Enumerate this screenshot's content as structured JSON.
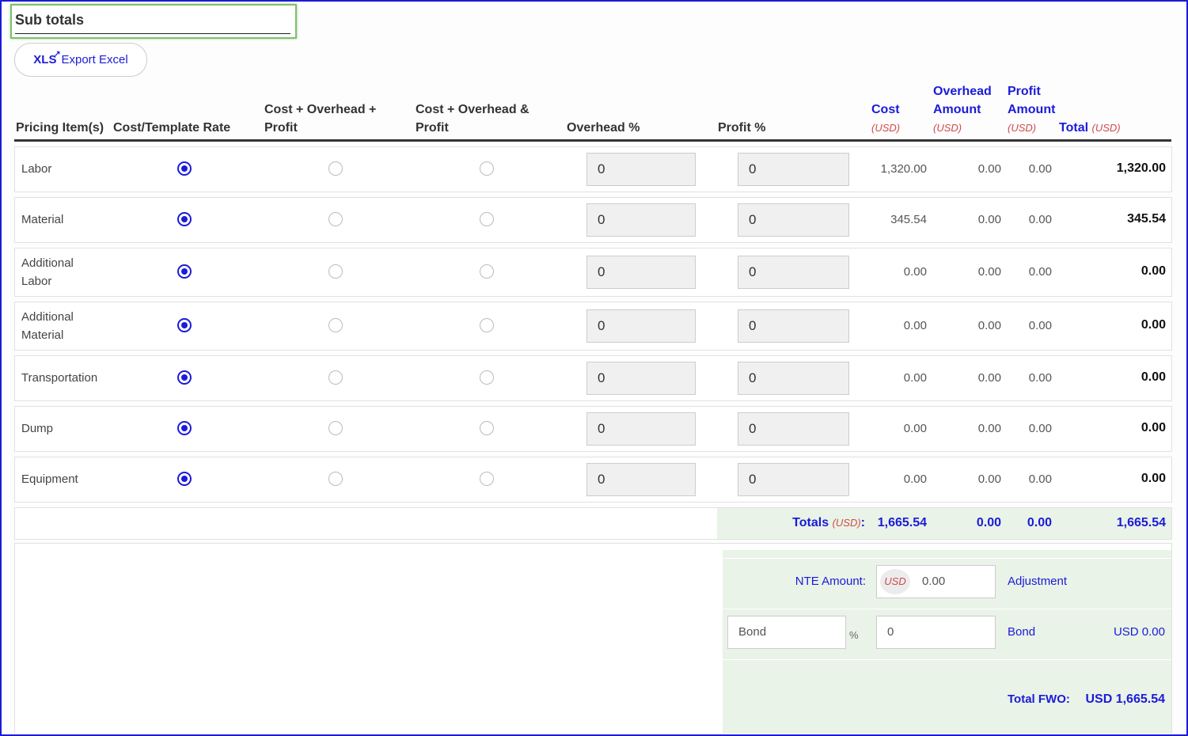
{
  "title": "Sub totals",
  "export": {
    "icon_text": "XLS",
    "label": "Export Excel"
  },
  "headers": {
    "pricing_items": "Pricing Item(s)",
    "cost_template_rate": "Cost/Template Rate",
    "cop_1": "Cost + Overhead +",
    "cop_2": "Profit",
    "coap_1": "Cost + Overhead &",
    "coap_2": "Profit",
    "overhead_pct": "Overhead %",
    "profit_pct": "Profit %",
    "cost": "Cost",
    "overhead_amount_1": "Overhead",
    "overhead_amount_2": "Amount",
    "profit_amount_1": "Profit",
    "profit_amount_2": "Amount",
    "total": "Total",
    "currency": "(USD)"
  },
  "rows": [
    {
      "label": "Labor",
      "selected": "cost_template_rate",
      "overhead_pct": "0",
      "profit_pct": "0",
      "cost": "1,320.00",
      "overhead_amount": "0.00",
      "profit_amount": "0.00",
      "total": "1,320.00"
    },
    {
      "label": "Material",
      "selected": "cost_template_rate",
      "overhead_pct": "0",
      "profit_pct": "0",
      "cost": "345.54",
      "overhead_amount": "0.00",
      "profit_amount": "0.00",
      "total": "345.54"
    },
    {
      "label_1": "Additional",
      "label_2": "Labor",
      "selected": "cost_template_rate",
      "overhead_pct": "0",
      "profit_pct": "0",
      "cost": "0.00",
      "overhead_amount": "0.00",
      "profit_amount": "0.00",
      "total": "0.00"
    },
    {
      "label_1": "Additional",
      "label_2": "Material",
      "selected": "cost_template_rate",
      "overhead_pct": "0",
      "profit_pct": "0",
      "cost": "0.00",
      "overhead_amount": "0.00",
      "profit_amount": "0.00",
      "total": "0.00"
    },
    {
      "label": "Transportation",
      "selected": "cost_template_rate",
      "overhead_pct": "0",
      "profit_pct": "0",
      "cost": "0.00",
      "overhead_amount": "0.00",
      "profit_amount": "0.00",
      "total": "0.00"
    },
    {
      "label": "Dump",
      "selected": "cost_template_rate",
      "overhead_pct": "0",
      "profit_pct": "0",
      "cost": "0.00",
      "overhead_amount": "0.00",
      "profit_amount": "0.00",
      "total": "0.00"
    },
    {
      "label": "Equipment",
      "selected": "cost_template_rate",
      "overhead_pct": "0",
      "profit_pct": "0",
      "cost": "0.00",
      "overhead_amount": "0.00",
      "profit_amount": "0.00",
      "total": "0.00"
    }
  ],
  "totals": {
    "label": "Totals",
    "currency": "(USD)",
    "colon": ":",
    "cost": "1,665.54",
    "overhead_amount": "0.00",
    "profit_amount": "0.00",
    "total": "1,665.54"
  },
  "nte": {
    "label": "NTE Amount:",
    "currency_badge": "USD",
    "value": "0.00",
    "adjustment_label": "Adjustment"
  },
  "bond": {
    "placeholder": "Bond",
    "pct_symbol": "%",
    "value": "0",
    "label": "Bond",
    "amount": "USD 0.00"
  },
  "total_fwo": {
    "label": "Total FWO:",
    "amount": "USD 1,665.54"
  },
  "colors": {
    "accent_blue": "#1b1bd8",
    "currency_red": "#d04a4a",
    "totals_green": "#e9f3e7",
    "title_border_green": "#7dc06b"
  }
}
